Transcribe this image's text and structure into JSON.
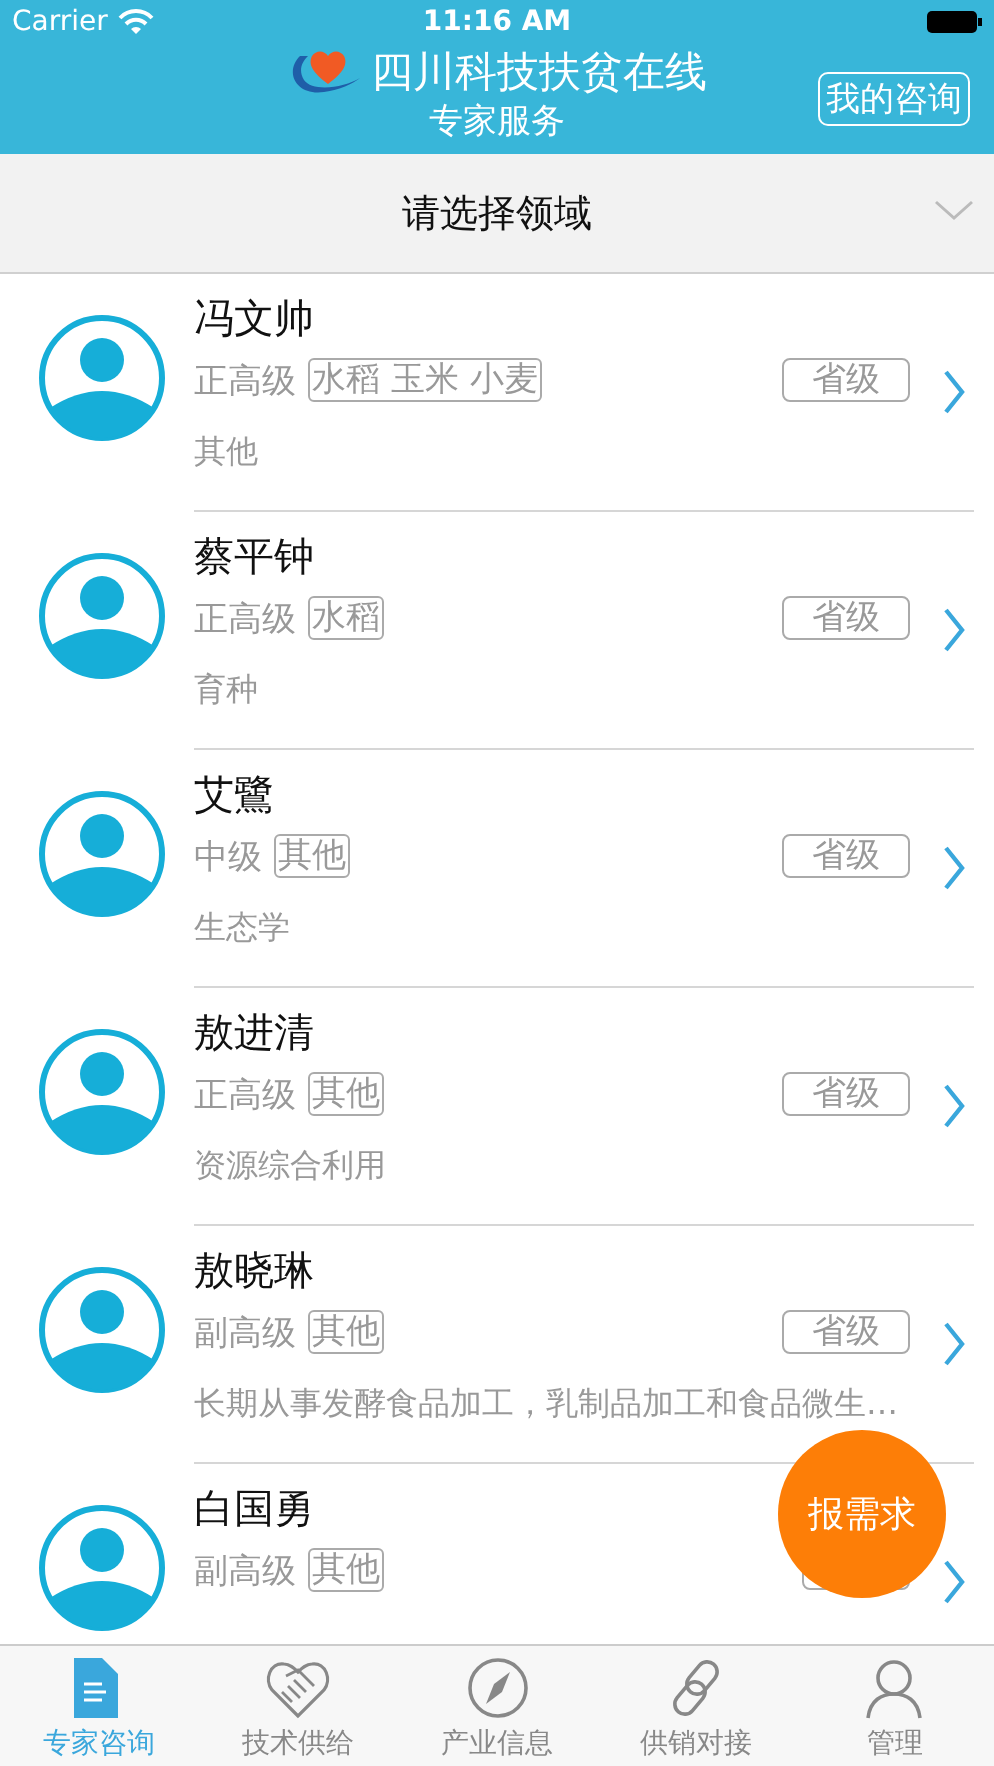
{
  "status_bar": {
    "carrier": "Carrier",
    "time": "11:16 AM"
  },
  "header": {
    "title": "四川科技扶贫在线",
    "subtitle": "专家服务",
    "action": "我的咨询"
  },
  "filter": {
    "label": "请选择领域"
  },
  "experts": [
    {
      "name": "冯文帅",
      "rank": "正高级",
      "fields": "水稻 玉米 小麦",
      "level": "省级",
      "desc": "其他"
    },
    {
      "name": "蔡平钟",
      "rank": "正高级",
      "fields": "水稻",
      "level": "省级",
      "desc": "育种"
    },
    {
      "name": "艾鷺",
      "rank": "中级",
      "fields": "其他",
      "level": "省级",
      "desc": "生态学"
    },
    {
      "name": "敖进清",
      "rank": "正高级",
      "fields": "其他",
      "level": "省级",
      "desc": "资源综合利用"
    },
    {
      "name": "敖晓琳",
      "rank": "副高级",
      "fields": "其他",
      "level": "省级",
      "desc": "长期从事发酵食品加工，乳制品加工和食品微生…"
    },
    {
      "name": "白国勇",
      "rank": "副高级",
      "fields": "其他"
    }
  ],
  "fab": {
    "label": "报需求"
  },
  "tabs": [
    {
      "label": "专家咨询",
      "kind": "document",
      "selected": true
    },
    {
      "label": "技术供给",
      "kind": "handshake",
      "selected": false
    },
    {
      "label": "产业信息",
      "kind": "compass",
      "selected": false
    },
    {
      "label": "供销对接",
      "kind": "link",
      "selected": false
    },
    {
      "label": "管理",
      "kind": "person",
      "selected": false
    }
  ]
}
